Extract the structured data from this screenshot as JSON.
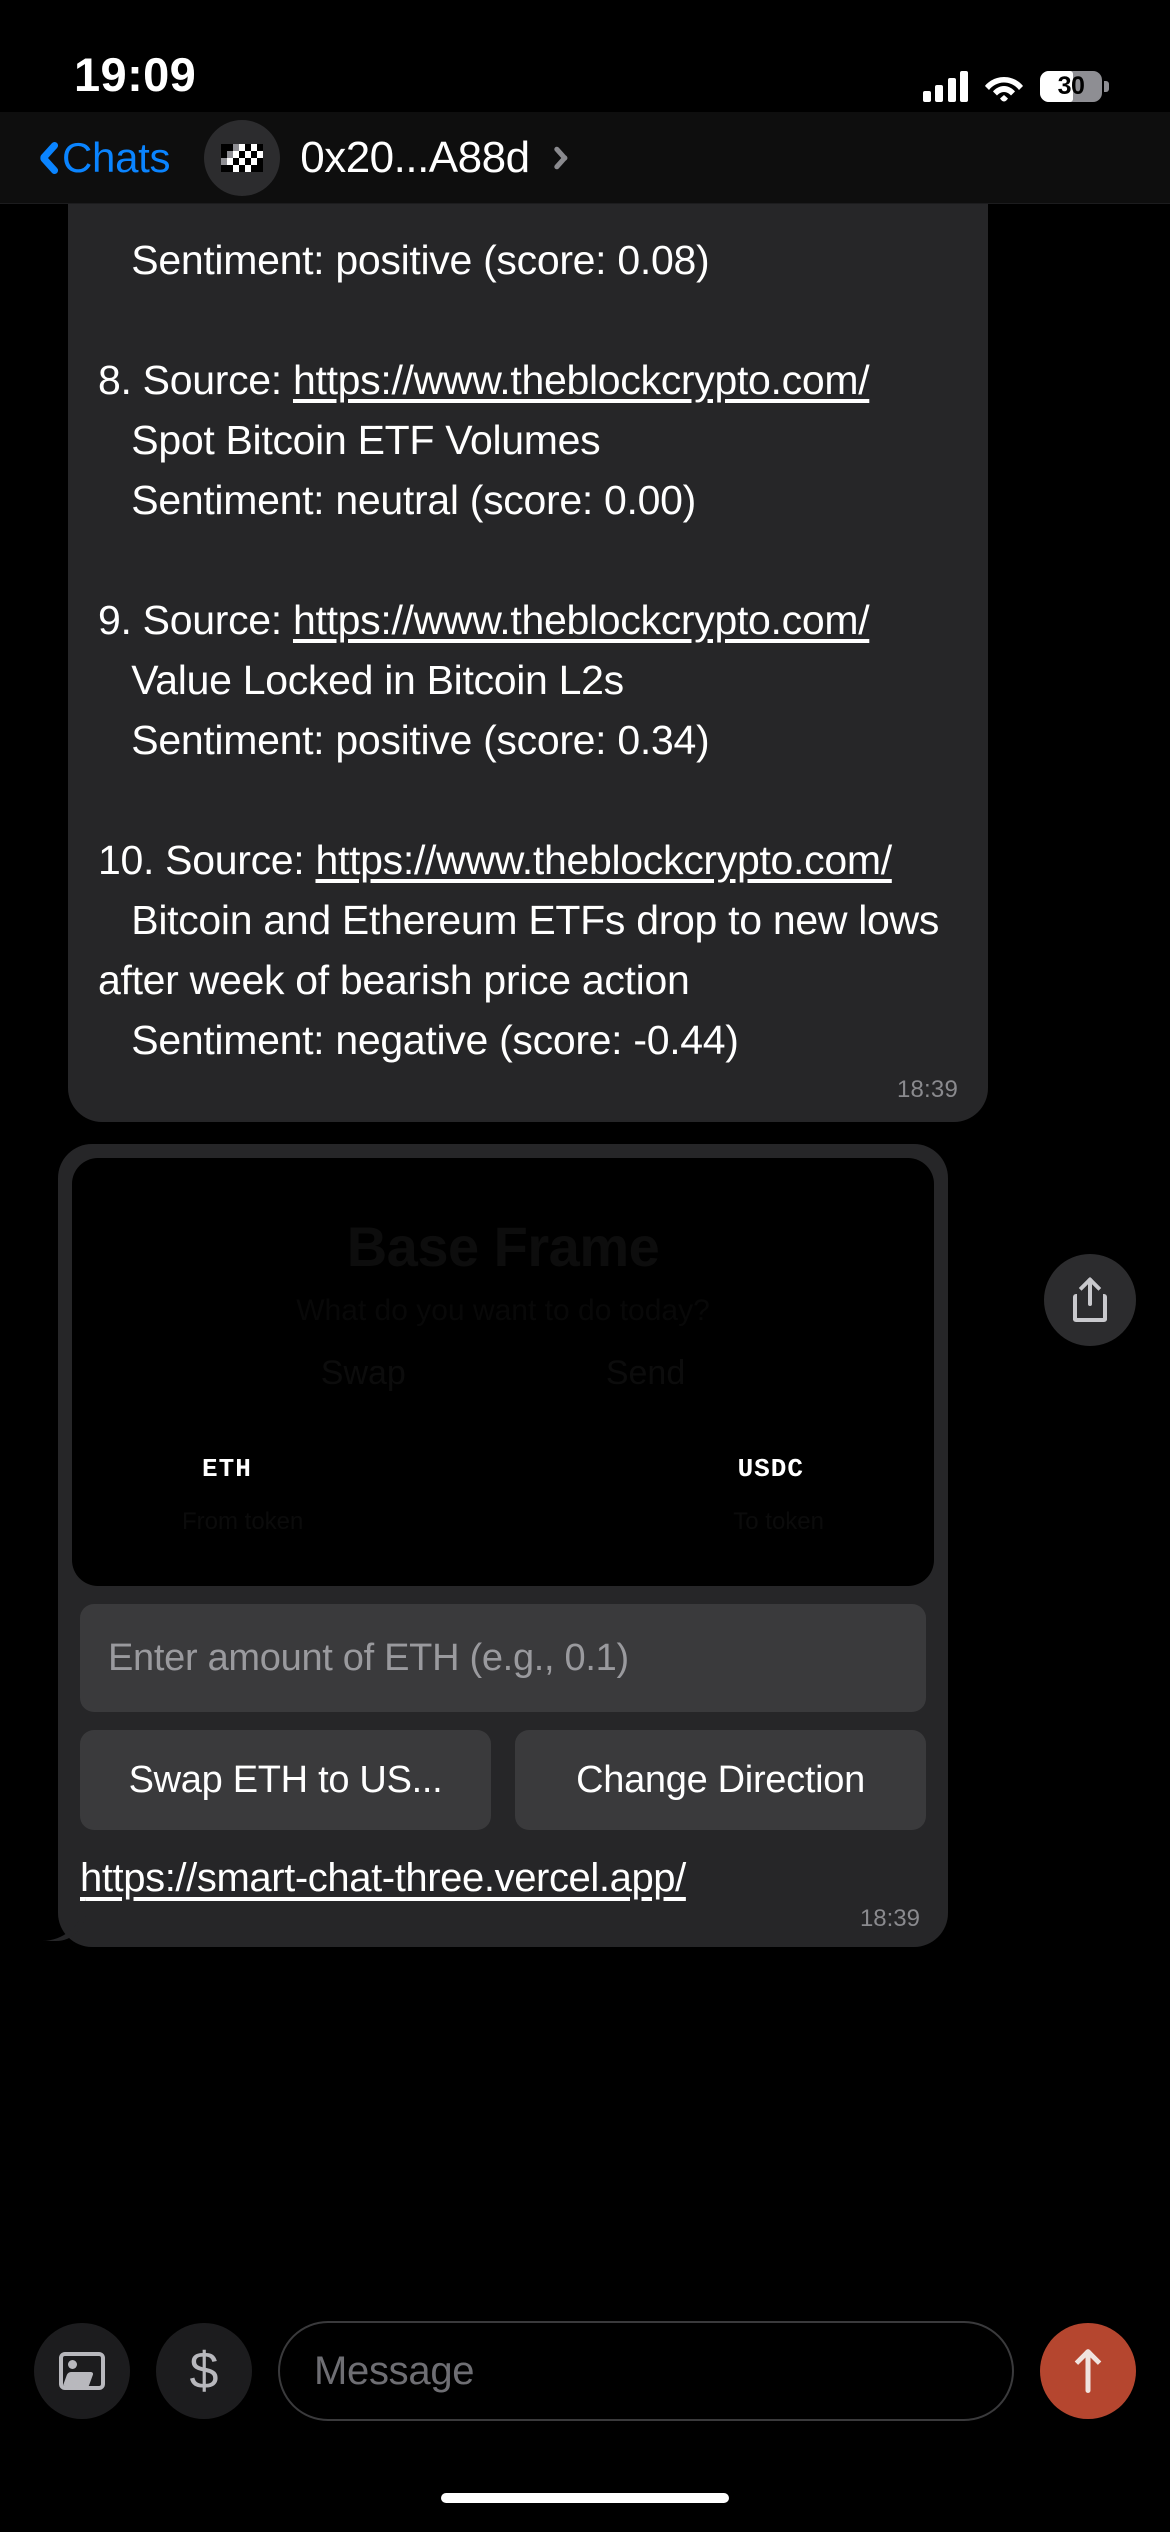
{
  "status_bar": {
    "time": "19:09",
    "battery_percent": "30",
    "icons": [
      "cellular-signal-icon",
      "wifi-icon",
      "battery-icon"
    ]
  },
  "nav_bar": {
    "back_label": "Chats",
    "back_icon": "chevron-left-icon",
    "avatar_icon": "wallet-identicon-avatar",
    "title": "0x20...A88d",
    "disclosure_icon": "chevron-right-icon"
  },
  "conversation": {
    "news_message": {
      "body": "   Sentiment: positive (score: 0.08)\n\n8. Source: https://www.theblockcrypto.com/\n   Spot Bitcoin ETF Volumes\n   Sentiment: neutral (score: 0.00)\n\n9. Source: https://www.theblockcrypto.com/\n   Value Locked in Bitcoin L2s\n   Sentiment: positive (score: 0.34)\n\n10. Source: https://www.theblockcrypto.com/\n   Bitcoin and Ethereum ETFs drop to new lows after week of bearish price action\n   Sentiment: negative (score: -0.44)",
      "timestamp": "18:39",
      "items": [
        {
          "index": "8",
          "source_label": "Source:",
          "url": "https://www.theblockcrypto.com/",
          "headline": "Spot Bitcoin ETF Volumes",
          "sentiment_label": "Sentiment:",
          "sentiment": "neutral",
          "score": "0.00"
        },
        {
          "index": "9",
          "source_label": "Source:",
          "url": "https://www.theblockcrypto.com/",
          "headline": "Value Locked in Bitcoin L2s",
          "sentiment_label": "Sentiment:",
          "sentiment": "positive",
          "score": "0.34"
        },
        {
          "index": "10",
          "source_label": "Source:",
          "url": "https://www.theblockcrypto.com/",
          "headline": "Bitcoin and Ethereum ETFs drop to new lows after week of bearish price action",
          "sentiment_label": "Sentiment:",
          "sentiment": "negative",
          "score": "-0.44"
        }
      ]
    },
    "frame_message": {
      "preview": {
        "title": "Base Frame",
        "subtitle": "What do you want to do today?",
        "tab_swap": "Swap",
        "tab_send": "Send",
        "token_from": "ETH",
        "token_to": "USDC",
        "from_caption": "From token",
        "to_caption": "To token"
      },
      "input_placeholder": "Enter amount of ETH (e.g., 0.1)",
      "buttons": [
        {
          "label": "Swap ETH to US..."
        },
        {
          "label": "Change Direction"
        }
      ],
      "link": "https://smart-chat-three.vercel.app/",
      "timestamp": "18:39"
    },
    "share_button_icon": "share-icon"
  },
  "composer": {
    "photo_icon": "photo-icon",
    "money_icon": "dollar-icon",
    "message_placeholder": "Message",
    "send_icon": "arrow-up-icon"
  },
  "colors": {
    "accent_blue": "#0a84ff",
    "send_red": "#b5462f",
    "bubble_gray": "#262628",
    "control_gray": "#3a3a3c",
    "background": "#000000"
  }
}
